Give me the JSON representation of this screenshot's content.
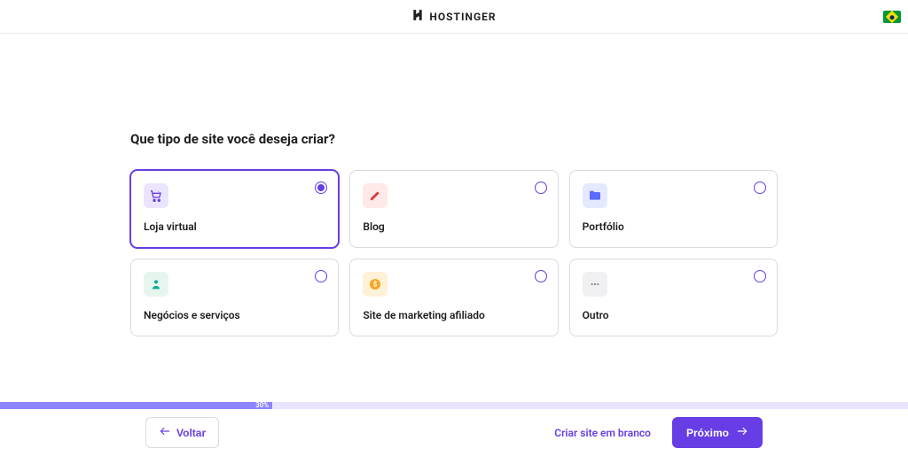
{
  "header": {
    "brand": "HOSTINGER",
    "locale_flag": "brazil"
  },
  "main": {
    "title": "Que tipo de site você deseja criar?",
    "options": [
      {
        "id": "store",
        "label": "Loja virtual",
        "icon": "cart-icon",
        "selected": true
      },
      {
        "id": "blog",
        "label": "Blog",
        "icon": "pencil-icon",
        "selected": false
      },
      {
        "id": "portfolio",
        "label": "Portfólio",
        "icon": "folder-icon",
        "selected": false
      },
      {
        "id": "business",
        "label": "Negócios e serviços",
        "icon": "person-icon",
        "selected": false
      },
      {
        "id": "affiliate",
        "label": "Site de marketing afiliado",
        "icon": "dollar-icon",
        "selected": false
      },
      {
        "id": "other",
        "label": "Outro",
        "icon": "dots-icon",
        "selected": false
      }
    ]
  },
  "progress": {
    "percent": 30,
    "percent_label": "30%"
  },
  "footer": {
    "back_label": "Voltar",
    "blank_label": "Criar site em branco",
    "next_label": "Próximo"
  },
  "colors": {
    "primary": "#673de6",
    "progress_bg": "#ebe4ff",
    "progress_fill": "#8c85ff"
  }
}
